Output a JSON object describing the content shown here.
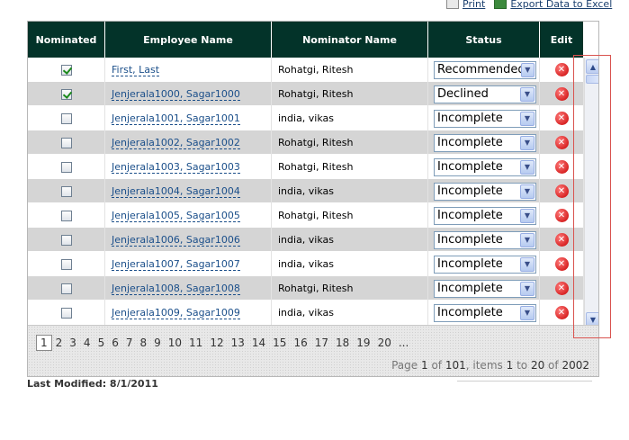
{
  "top_links": {
    "print": "Print",
    "export": "Export Data to Excel"
  },
  "columns": {
    "nominated": "Nominated",
    "employee": "Employee Name",
    "nominator": "Nominator Name",
    "status": "Status",
    "edit": "Edit"
  },
  "rows": [
    {
      "checked": true,
      "employee": "First, Last",
      "nominator": "Rohatgi, Ritesh",
      "status": "Recommended"
    },
    {
      "checked": true,
      "employee": "Jenjerala1000, Sagar1000",
      "nominator": "Rohatgi, Ritesh",
      "status": "Declined"
    },
    {
      "checked": false,
      "employee": "Jenjerala1001, Sagar1001",
      "nominator": "india, vikas",
      "status": "Incomplete"
    },
    {
      "checked": false,
      "employee": "Jenjerala1002, Sagar1002",
      "nominator": "Rohatgi, Ritesh",
      "status": "Incomplete"
    },
    {
      "checked": false,
      "employee": "Jenjerala1003, Sagar1003",
      "nominator": "Rohatgi, Ritesh",
      "status": "Incomplete"
    },
    {
      "checked": false,
      "employee": "Jenjerala1004, Sagar1004",
      "nominator": "india, vikas",
      "status": "Incomplete"
    },
    {
      "checked": false,
      "employee": "Jenjerala1005, Sagar1005",
      "nominator": "Rohatgi, Ritesh",
      "status": "Incomplete"
    },
    {
      "checked": false,
      "employee": "Jenjerala1006, Sagar1006",
      "nominator": "india, vikas",
      "status": "Incomplete"
    },
    {
      "checked": false,
      "employee": "Jenjerala1007, Sagar1007",
      "nominator": "india, vikas",
      "status": "Incomplete"
    },
    {
      "checked": false,
      "employee": "Jenjerala1008, Sagar1008",
      "nominator": "Rohatgi, Ritesh",
      "status": "Incomplete"
    },
    {
      "checked": false,
      "employee": "Jenjerala1009, Sagar1009",
      "nominator": "india, vikas",
      "status": "Incomplete"
    }
  ],
  "pager": {
    "pages": [
      "1",
      "2",
      "3",
      "4",
      "5",
      "6",
      "7",
      "8",
      "9",
      "10",
      "11",
      "12",
      "13",
      "14",
      "15",
      "16",
      "17",
      "18",
      "19",
      "20"
    ],
    "more": "...",
    "current": "1",
    "info": {
      "page_label": "Page",
      "page": "1",
      "of_label": "of",
      "total_pages": "101",
      "items_label": ", items",
      "from": "1",
      "to_label": "to",
      "to": "20",
      "of2_label": "of",
      "total_items": "2002"
    }
  },
  "footer": {
    "last_modified": "Last Modified: 8/1/2011"
  },
  "icons": {
    "delete": "delete-x-icon",
    "checkbox": "checkbox-icon",
    "dropdown": "chevron-down-icon"
  },
  "colors": {
    "header_bg": "#033329",
    "alt_row": "#d5d5d5",
    "link": "#1b4f8a",
    "delete": "#c80000",
    "highlight": "#d9534f"
  }
}
